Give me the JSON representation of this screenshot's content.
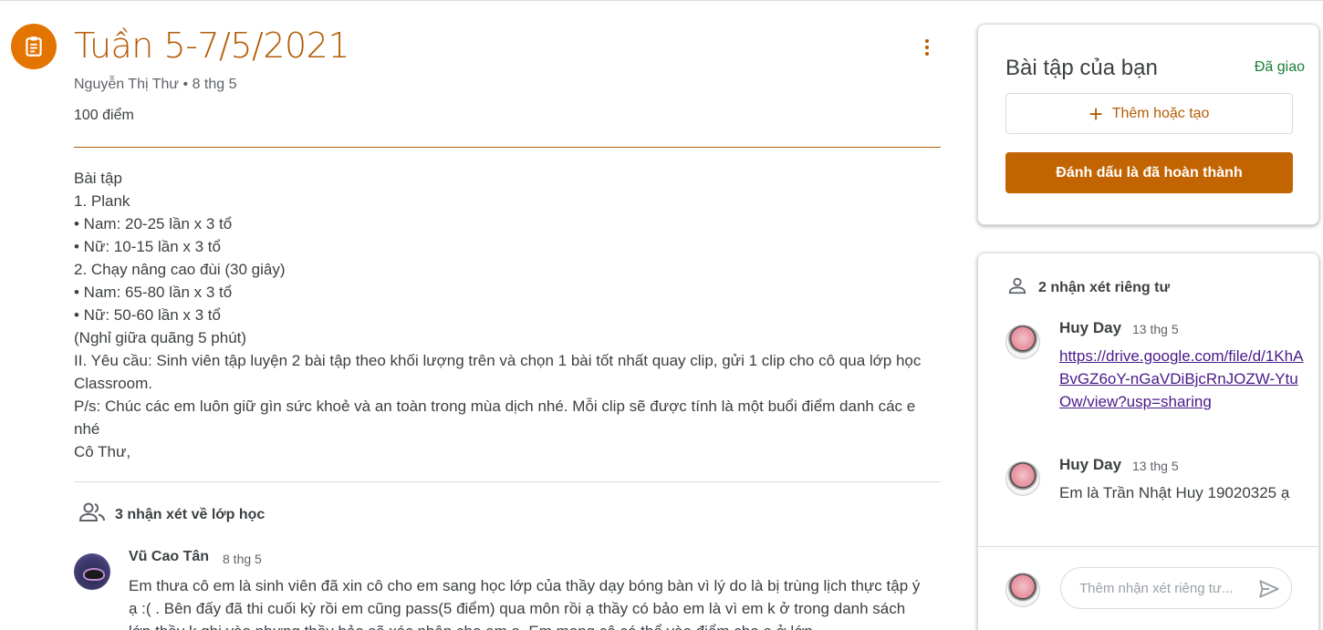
{
  "header": {
    "title": "Tuần 5-7/5/2021",
    "author_date": "Nguyễn Thị Thư • 8 thg 5",
    "points": "100 điểm"
  },
  "instructions": [
    "Bài tập",
    "1. Plank",
    "• Nam: 20-25 lần x 3 tổ",
    "• Nữ: 10-15 lần x 3 tổ",
    "2. Chạy nâng cao đùi (30 giây)",
    "• Nam: 65-80 lần x 3 tổ",
    "• Nữ: 50-60 lần x 3 tổ",
    "(Nghỉ giữa quãng 5 phút)",
    "II. Yêu cầu: Sinh viên tập luyện 2 bài tập theo khối lượng trên và chọn 1 bài tốt nhất quay clip, gửi 1 clip cho cô qua lớp học Classroom.",
    "P/s: Chúc các em luôn giữ gìn sức khoẻ và an toàn trong mùa dịch nhé. Mỗi clip sẽ được tính là một buổi điểm danh các e nhé",
    "Cô Thư,"
  ],
  "class_comments": {
    "label": "3 nhận xét về lớp học",
    "first": {
      "author": "Vũ Cao Tân",
      "date": "8 thg 5",
      "text": "Em thưa cô em là sinh viên đã xin cô cho em sang học lớp của thầy dạy bóng bàn vì lý do là bị trùng lịch thực tập ý ạ :( . Bên đấy đã thi cuối kỳ rồi em cũng pass(5 điểm) qua môn rồi ạ thầy có bảo em là vì em k ở trong danh sách lớp thầy k ghi vào nhưng thầy bảo sẽ xác nhận cho em ạ. Em mong cô có thể vào điểm cho e ở lớp"
    }
  },
  "your_work": {
    "title": "Bài tập của bạn",
    "status": "Đã giao",
    "add_label": "Thêm hoặc tạo",
    "mark_done_label": "Đánh dấu là đã hoàn thành"
  },
  "private_comments": {
    "label": "2 nhận xét riêng tư",
    "items": [
      {
        "author": "Huy Day",
        "date": "13 thg 5",
        "text": "https://drive.google.com/file/d/1KhABvGZ6oY-nGaVDiBjcRnJOZW-YtuOw/view?usp=sharing"
      },
      {
        "author": "Huy Day",
        "date": "13 thg 5",
        "text": "Em là Trần Nhật Huy 19020325 ạ"
      }
    ],
    "input_placeholder": "Thêm nhận xét riêng tư..."
  },
  "colors": {
    "accent": "#b45c06",
    "button": "#c26401",
    "status_green": "#188038",
    "link": "#4a1a8a"
  },
  "icons": [
    "assignment-icon",
    "more-vert-icon",
    "plus-icon",
    "people-icon",
    "person-icon",
    "send-icon"
  ]
}
